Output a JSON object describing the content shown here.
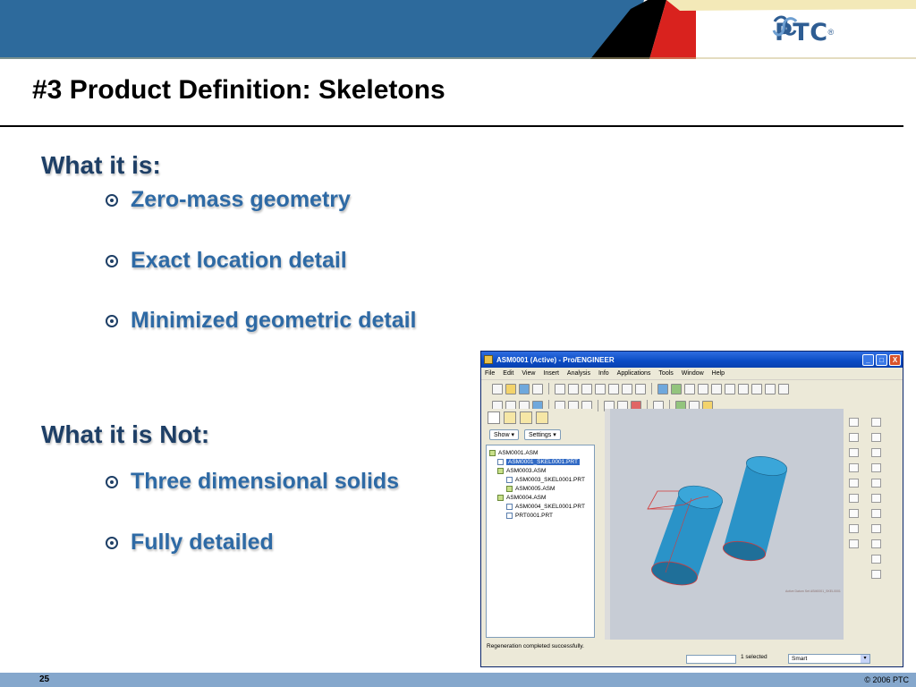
{
  "slide": {
    "title": "#3 Product Definition: Skeletons",
    "logo_text": "PTC",
    "logo_tm": "®",
    "sections": [
      {
        "heading": "What it is:",
        "bullets": [
          "Zero-mass geometry",
          "Exact location detail",
          "Minimized geometric detail"
        ]
      },
      {
        "heading": "What it is Not:",
        "bullets": [
          "Three dimensional solids",
          "Fully detailed"
        ]
      }
    ],
    "page_number": "25",
    "copyright": "© 2006 PTC",
    "colors": {
      "header_blue": "#2d6a9c",
      "accent_red": "#d9221e",
      "heading": "#1e3f66",
      "bullet_text": "#2e6aa5",
      "footer": "#85a7cc"
    }
  },
  "proe": {
    "window_title": "ASM0001 (Active) - Pro/ENGINEER",
    "title_buttons": [
      "_",
      "□",
      "X"
    ],
    "menu": [
      "File",
      "Edit",
      "View",
      "Insert",
      "Analysis",
      "Info",
      "Applications",
      "Tools",
      "Window",
      "Help"
    ],
    "show_label": "Show ▾",
    "settings_label": "Settings ▾",
    "tree": [
      "ASM0001.ASM",
      "ASM0001_SKEL0001.PRT",
      "ASM0003.ASM",
      "ASM0003_SKEL0001.PRT",
      "ASM0005.ASM",
      "ASM0004.ASM",
      "ASM0004_SKEL0001.PRT",
      "PRT0001.PRT"
    ],
    "message": "Regeneration completed successfully.",
    "selection_count": "1 selected",
    "filter_value": "Smart",
    "filter_arrow": "▾",
    "graphics_note": "Active Datum Set ASM0001_SKEL0001"
  }
}
